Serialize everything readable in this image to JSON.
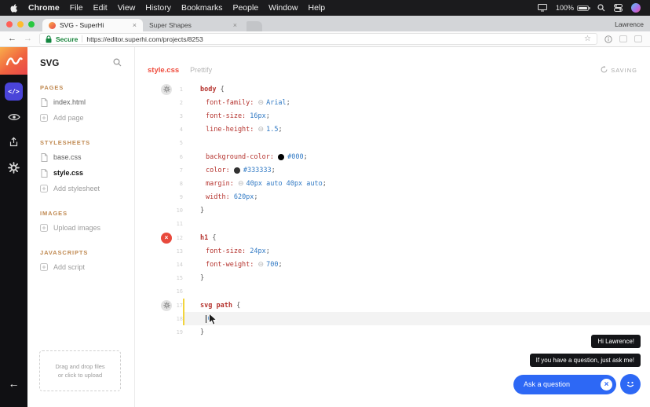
{
  "icons": {
    "adjuster": "⊖",
    "add": "⊕",
    "close": "×",
    "star": "☆",
    "back": "←",
    "forward": "→",
    "code": "</>",
    "rail_back": "←"
  },
  "menubar": {
    "items": [
      "Chrome",
      "File",
      "Edit",
      "View",
      "History",
      "Bookmarks",
      "People",
      "Window",
      "Help"
    ],
    "battery": "100%"
  },
  "browser": {
    "tabs": [
      {
        "title": "SVG - SuperHi",
        "active": true
      },
      {
        "title": "Super Shapes",
        "active": false
      }
    ],
    "profile": "Lawrence",
    "secure_label": "Secure",
    "url": "https://editor.superhi.com/projects/8253"
  },
  "panel": {
    "title": "SVG",
    "sections": [
      {
        "label": "PAGES",
        "items": [
          {
            "label": "index.html",
            "icon": "file"
          },
          {
            "label": "Add page",
            "icon": "add"
          }
        ]
      },
      {
        "label": "STYLESHEETS",
        "items": [
          {
            "label": "base.css",
            "icon": "file"
          },
          {
            "label": "style.css",
            "icon": "file",
            "active": true
          },
          {
            "label": "Add stylesheet",
            "icon": "add"
          }
        ]
      },
      {
        "label": "IMAGES",
        "items": [
          {
            "label": "Upload images",
            "icon": "add"
          }
        ]
      },
      {
        "label": "JAVASCRIPTS",
        "items": [
          {
            "label": "Add script",
            "icon": "add"
          }
        ]
      }
    ],
    "dropzone": {
      "line1": "Drag and drop files",
      "line2": "or click to upload"
    }
  },
  "editor": {
    "filename": "style.css",
    "prettify": "Prettify",
    "saving": "SAVING"
  },
  "code": {
    "lines": [
      {
        "n": "1",
        "gutter": "gear",
        "tokens": [
          [
            "sel",
            "body"
          ],
          [
            "pun",
            " {"
          ]
        ]
      },
      {
        "n": "2",
        "ind": 1,
        "tokens": [
          [
            "prop",
            "font-family: "
          ],
          [
            "adj",
            ""
          ],
          [
            "val",
            "Arial"
          ],
          [
            "pun",
            ";"
          ]
        ]
      },
      {
        "n": "3",
        "ind": 1,
        "tokens": [
          [
            "prop",
            "font-size: "
          ],
          [
            "val",
            "16px"
          ],
          [
            "pun",
            ";"
          ]
        ]
      },
      {
        "n": "4",
        "ind": 1,
        "tokens": [
          [
            "prop",
            "line-height: "
          ],
          [
            "adj",
            ""
          ],
          [
            "val",
            "1.5"
          ],
          [
            "pun",
            ";"
          ]
        ]
      },
      {
        "n": "5",
        "tokens": []
      },
      {
        "n": "6",
        "ind": 1,
        "tokens": [
          [
            "prop",
            "background-color: "
          ],
          [
            "swatch",
            "#000000"
          ],
          [
            "val",
            "#000"
          ],
          [
            "pun",
            ";"
          ]
        ]
      },
      {
        "n": "7",
        "ind": 1,
        "tokens": [
          [
            "prop",
            "color: "
          ],
          [
            "swatch",
            "#333333"
          ],
          [
            "val",
            "#333333"
          ],
          [
            "pun",
            ";"
          ]
        ]
      },
      {
        "n": "8",
        "ind": 1,
        "tokens": [
          [
            "prop",
            "margin: "
          ],
          [
            "adj",
            ""
          ],
          [
            "val",
            "40px auto 40px auto"
          ],
          [
            "pun",
            ";"
          ]
        ]
      },
      {
        "n": "9",
        "ind": 1,
        "tokens": [
          [
            "prop",
            "width: "
          ],
          [
            "val",
            "620px"
          ],
          [
            "pun",
            ";"
          ]
        ]
      },
      {
        "n": "10",
        "tokens": [
          [
            "pun",
            "}"
          ]
        ]
      },
      {
        "n": "11",
        "tokens": []
      },
      {
        "n": "12",
        "gutter": "error",
        "tokens": [
          [
            "sel",
            "h1"
          ],
          [
            "pun",
            " {"
          ]
        ]
      },
      {
        "n": "13",
        "ind": 1,
        "tokens": [
          [
            "prop",
            "font-size: "
          ],
          [
            "val",
            "24px"
          ],
          [
            "pun",
            ";"
          ]
        ]
      },
      {
        "n": "14",
        "ind": 1,
        "tokens": [
          [
            "prop",
            "font-weight: "
          ],
          [
            "adj",
            ""
          ],
          [
            "val",
            "700"
          ],
          [
            "pun",
            ";"
          ]
        ]
      },
      {
        "n": "15",
        "tokens": [
          [
            "pun",
            "}"
          ]
        ]
      },
      {
        "n": "16",
        "tokens": []
      },
      {
        "n": "17",
        "gutter": "gear",
        "bar": true,
        "tokens": [
          [
            "sel",
            "svg path"
          ],
          [
            "pun",
            " {"
          ]
        ]
      },
      {
        "n": "18",
        "ind": 1,
        "bar": true,
        "current": true,
        "tokens": [
          [
            "add",
            ""
          ]
        ]
      },
      {
        "n": "19",
        "tokens": [
          [
            "pun",
            "}"
          ]
        ]
      }
    ]
  },
  "chat": {
    "tooltip_greeting": "Hi Lawrence!",
    "tooltip_prompt": "If you have a question, just ask me!",
    "button_label": "Ask a question"
  }
}
